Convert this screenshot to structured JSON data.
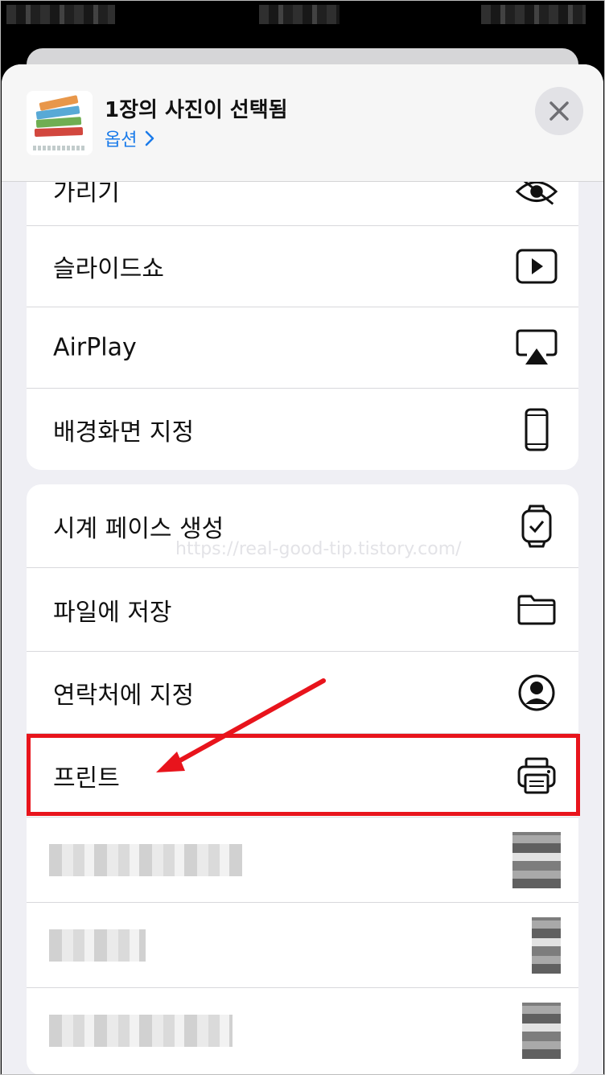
{
  "share_sheet": {
    "title": "1장의 사진이 선택됨",
    "options_label": "옵션",
    "close_label": "✕"
  },
  "group1": {
    "items": [
      {
        "label": "가리기",
        "icon": "hide-icon"
      },
      {
        "label": "슬라이드쇼",
        "icon": "play-icon"
      },
      {
        "label": "AirPlay",
        "icon": "airplay-icon"
      },
      {
        "label": "배경화면 지정",
        "icon": "phone-icon"
      }
    ]
  },
  "group2": {
    "items": [
      {
        "label": "시계 페이스 생성",
        "icon": "watch-icon"
      },
      {
        "label": "파일에 저장",
        "icon": "folder-icon"
      },
      {
        "label": "연락처에 지정",
        "icon": "contact-icon"
      },
      {
        "label": "프린트",
        "icon": "printer-icon"
      }
    ]
  },
  "watermark": "https://real-good-tip.tistory.com/",
  "colors": {
    "accent": "#1a7bea",
    "highlight": "#e8141c",
    "sheet_bg": "#efeff4",
    "card_bg": "#ffffff"
  }
}
